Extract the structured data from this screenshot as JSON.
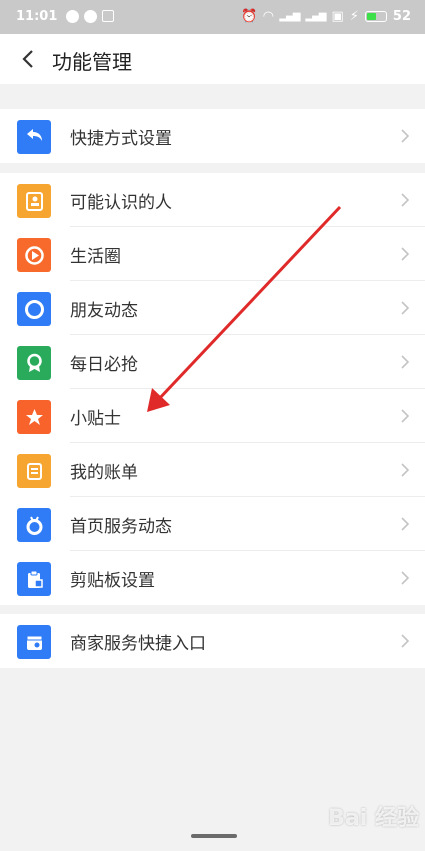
{
  "status_bar": {
    "time": "11:01",
    "battery": "52",
    "battery_level": 0.52
  },
  "header": {
    "title": "功能管理"
  },
  "groups": [
    {
      "items": [
        {
          "label": "快捷方式设置",
          "icon": "shortcut-icon",
          "color": "#2f7cf6"
        }
      ]
    },
    {
      "items": [
        {
          "label": "可能认识的人",
          "icon": "contact-card-icon",
          "color": "#f7a531"
        },
        {
          "label": "生活圈",
          "icon": "life-circle-icon",
          "color": "#f76a2b"
        },
        {
          "label": "朋友动态",
          "icon": "friends-moments-icon",
          "color": "#2f7cf6"
        },
        {
          "label": "每日必抢",
          "icon": "daily-deal-icon",
          "color": "#2aab5c"
        },
        {
          "label": "小贴士",
          "icon": "tips-icon",
          "color": "#f7632b"
        },
        {
          "label": "我的账单",
          "icon": "bill-icon",
          "color": "#f7a531"
        },
        {
          "label": "首页服务动态",
          "icon": "home-service-icon",
          "color": "#2f7cf6"
        },
        {
          "label": "剪贴板设置",
          "icon": "clipboard-icon",
          "color": "#2f7cf6"
        }
      ]
    },
    {
      "items": [
        {
          "label": "商家服务快捷入口",
          "icon": "merchant-service-icon",
          "color": "#2f7cf6"
        }
      ]
    }
  ],
  "annotation": {
    "color": "#e02a2a"
  },
  "watermark": "Bai 经验"
}
